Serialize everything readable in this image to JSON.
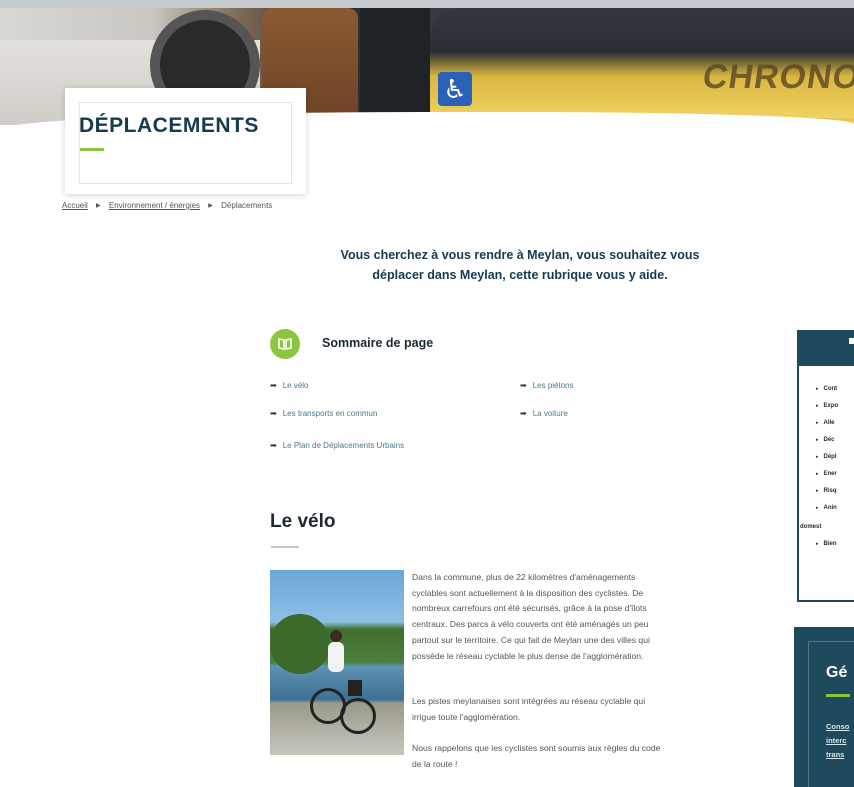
{
  "hero": {
    "brand_text": "CHRONO",
    "accessibility_symbol": "♿"
  },
  "page": {
    "title": "DÉPLACEMENTS",
    "accent_color": "#8cc63f",
    "primary_color": "#163a4e"
  },
  "breadcrumb": {
    "items": [
      "Accueil",
      "Environnement / énergies",
      "Déplacements"
    ]
  },
  "intro": {
    "line1": "Vous cherchez à vous rendre à Meylan, vous souhaitez vous",
    "line2": "déplacer dans Meylan, cette rubrique vous y aide."
  },
  "summary": {
    "icon": "book-open-icon",
    "title": "Sommaire de page",
    "links": [
      "Le vélo",
      "Les piétons",
      "Les transports en commun",
      "La voiture",
      "Le Plan de Déplacements Urbains"
    ]
  },
  "section": {
    "title": "Le vélo",
    "photo_alt": "cycliste-au-bord-du-lac",
    "paragraphs": [
      [
        " Dans la commune, plus de 22 kilomètres d'aménagements",
        "cyclables sont actuellement à la disposition des cyclistes. De",
        "nombreux carrefours ont été sécurisés, grâce à la pose d'îlots",
        "centraux. Des parcs à vélo couverts ont été aménagés un peu",
        "partout sur le territoire. Ce qui fait de Meylan une des villes qui",
        "possède le réseau cyclable le plus dense de l'agglomération."
      ],
      [
        "Les pistes meylanaises sont intégrées au réseau cyclable qui",
        "irrigue toute l'agglomération."
      ],
      [
        "Nous rappelons que les cyclistes sont soumis aux règles du code",
        "de la route !"
      ]
    ]
  },
  "sidebar": {
    "items": [
      "Cont",
      "Expo",
      "Alle",
      "Déc",
      "Dépl",
      "Ener",
      "Risq",
      "Anin",
      "domest",
      "Bien"
    ],
    "box2_title": "Gé",
    "box2_links": [
      "Conso",
      "interc",
      "trans"
    ]
  }
}
